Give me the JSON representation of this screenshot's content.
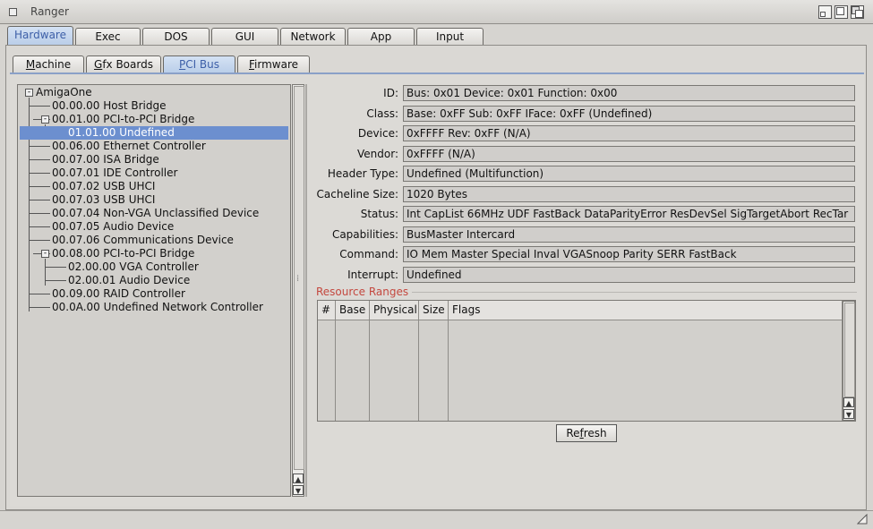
{
  "window": {
    "title": "Ranger"
  },
  "main_tabs": [
    "Hardware",
    "Exec",
    "DOS",
    "GUI",
    "Network",
    "App",
    "Input"
  ],
  "sub_tabs": [
    {
      "pre": "",
      "ul": "M",
      "post": "achine"
    },
    {
      "pre": "",
      "ul": "G",
      "post": "fx Boards"
    },
    {
      "pre": "",
      "ul": "P",
      "post": "CI Bus"
    },
    {
      "pre": "",
      "ul": "F",
      "post": "irmware"
    }
  ],
  "tree": [
    "AmigaOne",
    "00.00.00 Host Bridge",
    "00.01.00 PCI-to-PCI Bridge",
    "01.01.00 Undefined",
    "00.06.00 Ethernet Controller",
    "00.07.00 ISA Bridge",
    "00.07.01 IDE Controller",
    "00.07.02 USB UHCI",
    "00.07.03 USB UHCI",
    "00.07.04 Non-VGA Unclassified Device",
    "00.07.05 Audio Device",
    "00.07.06 Communications Device",
    "00.08.00 PCI-to-PCI Bridge",
    "02.00.00 VGA Controller",
    "02.00.01 Audio Device",
    "00.09.00 RAID Controller",
    "00.0A.00 Undefined Network Controller"
  ],
  "properties": [
    {
      "label": "ID:",
      "value": "Bus: 0x01 Device: 0x01 Function: 0x00"
    },
    {
      "label": "Class:",
      "value": "Base: 0xFF Sub: 0xFF IFace: 0xFF (Undefined)"
    },
    {
      "label": "Device:",
      "value": "0xFFFF Rev: 0xFF (N/A)"
    },
    {
      "label": "Vendor:",
      "value": "0xFFFF (N/A)"
    },
    {
      "label": "Header Type:",
      "value": "Undefined (Multifunction)"
    },
    {
      "label": "Cacheline Size:",
      "value": "1020 Bytes"
    },
    {
      "label": "Status:",
      "value": "Int CapList 66MHz UDF FastBack DataParityError ResDevSel SigTargetAbort RecTar"
    },
    {
      "label": "Capabilities:",
      "value": "BusMaster Intercard"
    },
    {
      "label": "Command:",
      "value": "IO Mem Master Special Inval VGASnoop Parity SERR FastBack"
    },
    {
      "label": "Interrupt:",
      "value": "Undefined"
    }
  ],
  "resource_ranges": {
    "title": "Resource Ranges",
    "columns": [
      "#",
      "Base",
      "Physical",
      "Size",
      "Flags"
    ]
  },
  "refresh": {
    "pre": "Re",
    "ul": "f",
    "post": "resh"
  },
  "colors": {
    "selection": "#6c8fcf",
    "active_tab": "#3d5fa8",
    "group_title": "#c4483f"
  },
  "icons": [
    "close-icon",
    "iconify-icon",
    "zoom-icon",
    "depth-icon",
    "collapse-icon",
    "scroll-up-icon",
    "scroll-down-icon",
    "resize-icon"
  ]
}
